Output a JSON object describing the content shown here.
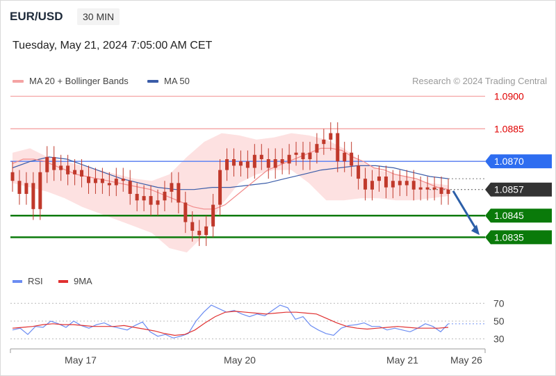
{
  "header": {
    "symbol": "EUR/USD",
    "timeframe": "30 MIN",
    "datetime": "Tuesday, May 21, 2024 7:05:00 AM CET"
  },
  "legend": {
    "ma20_label": "MA 20 + Bollinger Bands",
    "ma50_label": "MA 50",
    "research": "Research © 2024 Trading Central"
  },
  "rsi_legend": {
    "rsi_label": "RSI",
    "ma9_label": "9MA"
  },
  "colors": {
    "ma20": "#f28b8b",
    "ma50": "#3a5ca8",
    "bollinger_fill": "#fde1e1",
    "candle": "#c0392b",
    "resistance": "#f4a3a3",
    "resistance_text": "#e00000",
    "pivot": "#6b8cf2",
    "pivot_label_bg": "#2e6df0",
    "current_label_bg": "#333333",
    "support": "#0a7a0a",
    "arrow": "#2c5fa8",
    "rsi": "#6b8cf2",
    "rsi_ma": "#e03030"
  },
  "chart_data": [
    {
      "type": "candlestick",
      "title": "EUR/USD",
      "timeframe": "30 MIN",
      "x_ticks": [
        "May 17",
        "May 20",
        "May 21",
        "May 26"
      ],
      "ylim": [
        1.0822,
        1.0904
      ],
      "levels": [
        {
          "value": "1.0900",
          "kind": "resistance"
        },
        {
          "value": "1.0885",
          "kind": "resistance"
        },
        {
          "value": "1.0870",
          "kind": "pivot"
        },
        {
          "value": "1.0857",
          "kind": "current"
        },
        {
          "value": "1.0845",
          "kind": "support"
        },
        {
          "value": "1.0835",
          "kind": "support"
        }
      ],
      "close": [
        1.0861,
        1.0855,
        1.086,
        1.0848,
        1.0865,
        1.0872,
        1.0866,
        1.0868,
        1.0864,
        1.0866,
        1.0863,
        1.086,
        1.0862,
        1.086,
        1.0859,
        1.0862,
        1.0861,
        1.0855,
        1.0852,
        1.0854,
        1.085,
        1.0852,
        1.0856,
        1.086,
        1.0851,
        1.0842,
        1.0838,
        1.0836,
        1.084,
        1.085,
        1.0866,
        1.0871,
        1.0868,
        1.087,
        1.0867,
        1.0873,
        1.0871,
        1.0867,
        1.0871,
        1.0869,
        1.0873,
        1.0874,
        1.0871,
        1.0874,
        1.0878,
        1.088,
        1.0883,
        1.087,
        1.0874,
        1.0868,
        1.0862,
        1.0857,
        1.0861,
        1.0863,
        1.0858,
        1.0861,
        1.0859,
        1.0861,
        1.0857,
        1.0858,
        1.0857,
        1.0858,
        1.0855,
        1.0857
      ],
      "ma20": [
        1.0869,
        1.0871,
        1.0871,
        1.087,
        1.0868,
        1.0866,
        1.0864,
        1.0863,
        1.0862,
        1.0861,
        1.086,
        1.0859,
        1.0858,
        1.0857,
        1.0855,
        1.0853,
        1.0851,
        1.0849,
        1.0848,
        1.0848,
        1.085,
        1.0854,
        1.0858,
        1.0862,
        1.0866,
        1.0868,
        1.087,
        1.0872,
        1.0874,
        1.0876,
        1.0876,
        1.0875,
        1.0872,
        1.087,
        1.0867,
        1.0866,
        1.0864,
        1.0863,
        1.0862,
        1.086,
        1.0858,
        1.0857
      ],
      "ma50": [
        1.0867,
        1.087,
        1.0872,
        1.0871,
        1.0868,
        1.0865,
        1.0862,
        1.086,
        1.0858,
        1.0857,
        1.0857,
        1.0858,
        1.0858,
        1.0859,
        1.086,
        1.0862,
        1.0864,
        1.0866,
        1.0867,
        1.0868,
        1.0868,
        1.0867,
        1.0865,
        1.0863,
        1.0862
      ],
      "bb_upper": [
        1.0874,
        1.0876,
        1.0872,
        1.087,
        1.0868,
        1.0866,
        1.0864,
        1.0862,
        1.0861,
        1.0864,
        1.0872,
        1.0879,
        1.0883,
        1.0882,
        1.088,
        1.0881,
        1.0883,
        1.0882,
        1.088,
        1.0876,
        1.087,
        1.0866,
        1.0864,
        1.0862,
        1.086,
        1.0859
      ],
      "bb_lower": [
        1.086,
        1.0858,
        1.0856,
        1.0853,
        1.0849,
        1.0846,
        1.0843,
        1.084,
        1.0837,
        1.083,
        1.0828,
        1.0836,
        1.085,
        1.086,
        1.0864,
        1.0866,
        1.0866,
        1.086,
        1.0852,
        1.0852,
        1.0853,
        1.0853,
        1.0852,
        1.0852,
        1.0853,
        1.0854
      ]
    },
    {
      "type": "line",
      "title": "RSI",
      "ylim": [
        25,
        75
      ],
      "y_ticks": [
        "70",
        "50",
        "30"
      ],
      "series": [
        {
          "name": "RSI",
          "values": [
            40,
            42,
            35,
            44,
            43,
            50,
            47,
            43,
            50,
            45,
            42,
            46,
            48,
            44,
            42,
            40,
            45,
            49,
            38,
            33,
            35,
            31,
            33,
            36,
            50,
            60,
            68,
            64,
            60,
            62,
            58,
            55,
            58,
            56,
            62,
            68,
            65,
            52,
            55,
            45,
            40,
            36,
            34,
            42,
            45,
            46,
            48,
            44,
            44,
            40,
            42,
            40,
            38,
            42,
            47,
            44,
            38,
            47
          ]
        },
        {
          "name": "9MA",
          "values": [
            42,
            43,
            44,
            46,
            47,
            46,
            46,
            45,
            44,
            44,
            44,
            45,
            43,
            41,
            39,
            36,
            34,
            35,
            40,
            48,
            55,
            60,
            61,
            60,
            59,
            58,
            59,
            60,
            60,
            59,
            58,
            53,
            48,
            44,
            42,
            41,
            42,
            43,
            44,
            43,
            42,
            42,
            42,
            43
          ]
        }
      ]
    }
  ]
}
